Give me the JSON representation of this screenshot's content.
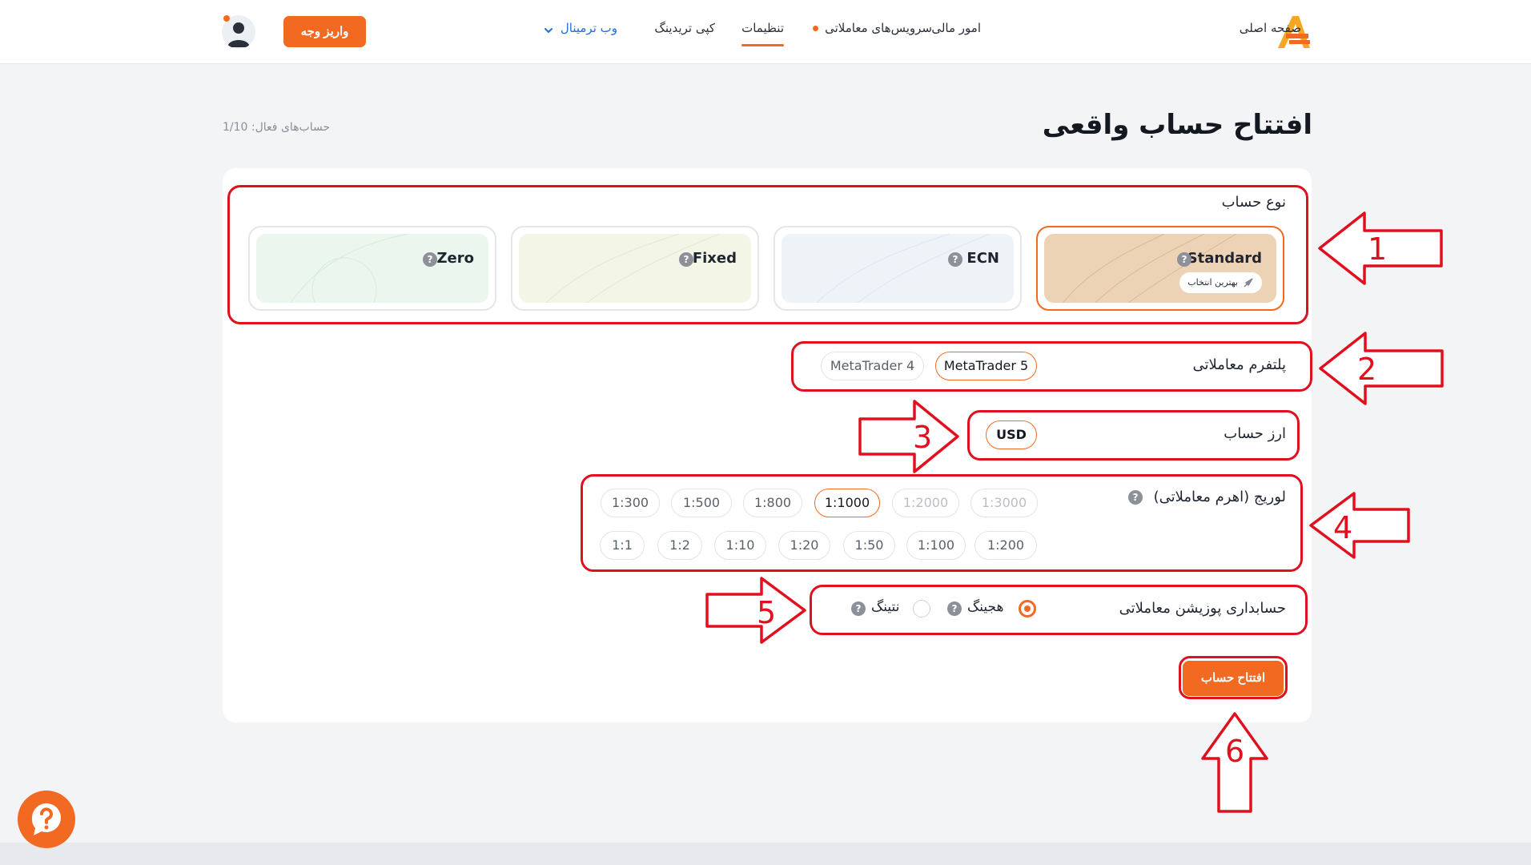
{
  "header": {
    "nav": {
      "home": "صفحه اصلی",
      "finance": "امور مالی",
      "trading_services": "سرویس‌های معاملاتی",
      "settings": "تنظیمات",
      "copy_trading": "کپی تریدینگ",
      "web_terminal": "وب ترمینال"
    },
    "deposit_label": "واریز وجه",
    "accent_color": "#f26a22",
    "icons": [
      "logo-icon",
      "chevron-down-icon",
      "avatar-icon",
      "notification-dot"
    ]
  },
  "page": {
    "title": "افتتاح حساب واقعی",
    "active_accounts": "حساب‌های فعال: 1/10"
  },
  "account_type": {
    "label": "نوع حساب",
    "types": [
      {
        "name": "Standard",
        "badge": "بهترین انتخاب",
        "selected": true,
        "tint": "#edd3b5"
      },
      {
        "name": "ECN",
        "badge": "",
        "selected": false,
        "tint": "#eef3f8"
      },
      {
        "name": "Fixed",
        "badge": "",
        "selected": false,
        "tint": "#f3f6e6"
      },
      {
        "name": "Zero",
        "badge": "",
        "selected": false,
        "tint": "#eaf6ee"
      }
    ],
    "help_glyph": "?"
  },
  "platform": {
    "label": "پلتفرم معاملاتی",
    "options": [
      "MetaTrader 5",
      "MetaTrader 4"
    ],
    "selected": "MetaTrader 5"
  },
  "currency": {
    "label": "ارز حساب",
    "options": [
      "USD"
    ],
    "selected": "USD"
  },
  "leverage": {
    "label": "لوریج (اهرم معاملاتی)",
    "row1": [
      "1:3000",
      "1:2000",
      "1:1000",
      "1:800",
      "1:500",
      "1:300"
    ],
    "row2": [
      "1:200",
      "1:100",
      "1:50",
      "1:20",
      "1:10",
      "1:2",
      "1:1"
    ],
    "selected": "1:1000",
    "disabled": [
      "1:3000",
      "1:2000"
    ]
  },
  "position_accounting": {
    "label": "حسابداری پوزیشن معاملاتی",
    "options": [
      {
        "label": "هجینگ",
        "checked": true
      },
      {
        "label": "نتینگ",
        "checked": false
      }
    ]
  },
  "submit_label": "افتتاح حساب",
  "annotations": {
    "numbers": [
      "1",
      "2",
      "3",
      "4",
      "5",
      "6"
    ],
    "color": "#e0101e"
  }
}
